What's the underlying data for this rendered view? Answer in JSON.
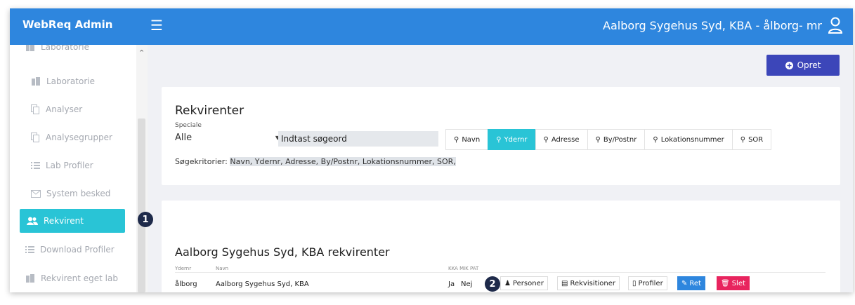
{
  "app": {
    "brand": "WebReq Admin",
    "user_context": "Aalborg Sygehus Syd, KBA - ålborg- mr"
  },
  "sidebar": {
    "items": [
      {
        "label": "Laboratorie"
      },
      {
        "label": "Laboratorie"
      },
      {
        "label": "Analyser"
      },
      {
        "label": "Analysegrupper"
      },
      {
        "label": "Lab Profiler"
      },
      {
        "label": "System besked"
      },
      {
        "label": "Rekvirent"
      },
      {
        "label": "Download Profiler"
      },
      {
        "label": "Rekvirent eget lab"
      }
    ]
  },
  "callouts": {
    "one": "1",
    "two": "2"
  },
  "toolbar": {
    "create_label": "Opret"
  },
  "search": {
    "title": "Rekvirenter",
    "speciale_label": "Speciale",
    "speciale_value": "Alle",
    "placeholder": "Indtast søgeord",
    "buttons": [
      "Navn",
      "Ydernr",
      "Adresse",
      "By/Postnr",
      "Lokationsnummer",
      "SOR"
    ],
    "active_button": "Ydernr",
    "criteria_label": "Søgekritorier:",
    "criteria_value": "Navn, Ydernr, Adresse, By/Postnr, Lokationsnummer, SOR,"
  },
  "results": {
    "title": "Aalborg Sygehus Syd, KBA rekvirenter",
    "columns": [
      "Ydernr",
      "Navn",
      "KKA MIK PAT"
    ],
    "rows": [
      {
        "ydernr": "ålborg",
        "navn": "Aalborg Sygehus Syd, KBA",
        "kka": "Ja",
        "mik": "Nej"
      }
    ],
    "actions": {
      "personer": "Personer",
      "rekvisitioner": "Rekvisitioner",
      "profiler": "Profiler",
      "ret": "Ret",
      "slet": "Slet"
    }
  },
  "colors": {
    "topbar": "#2e86de",
    "accent": "#29c4d6",
    "primary": "#3c46b9",
    "danger": "#e8245e"
  }
}
